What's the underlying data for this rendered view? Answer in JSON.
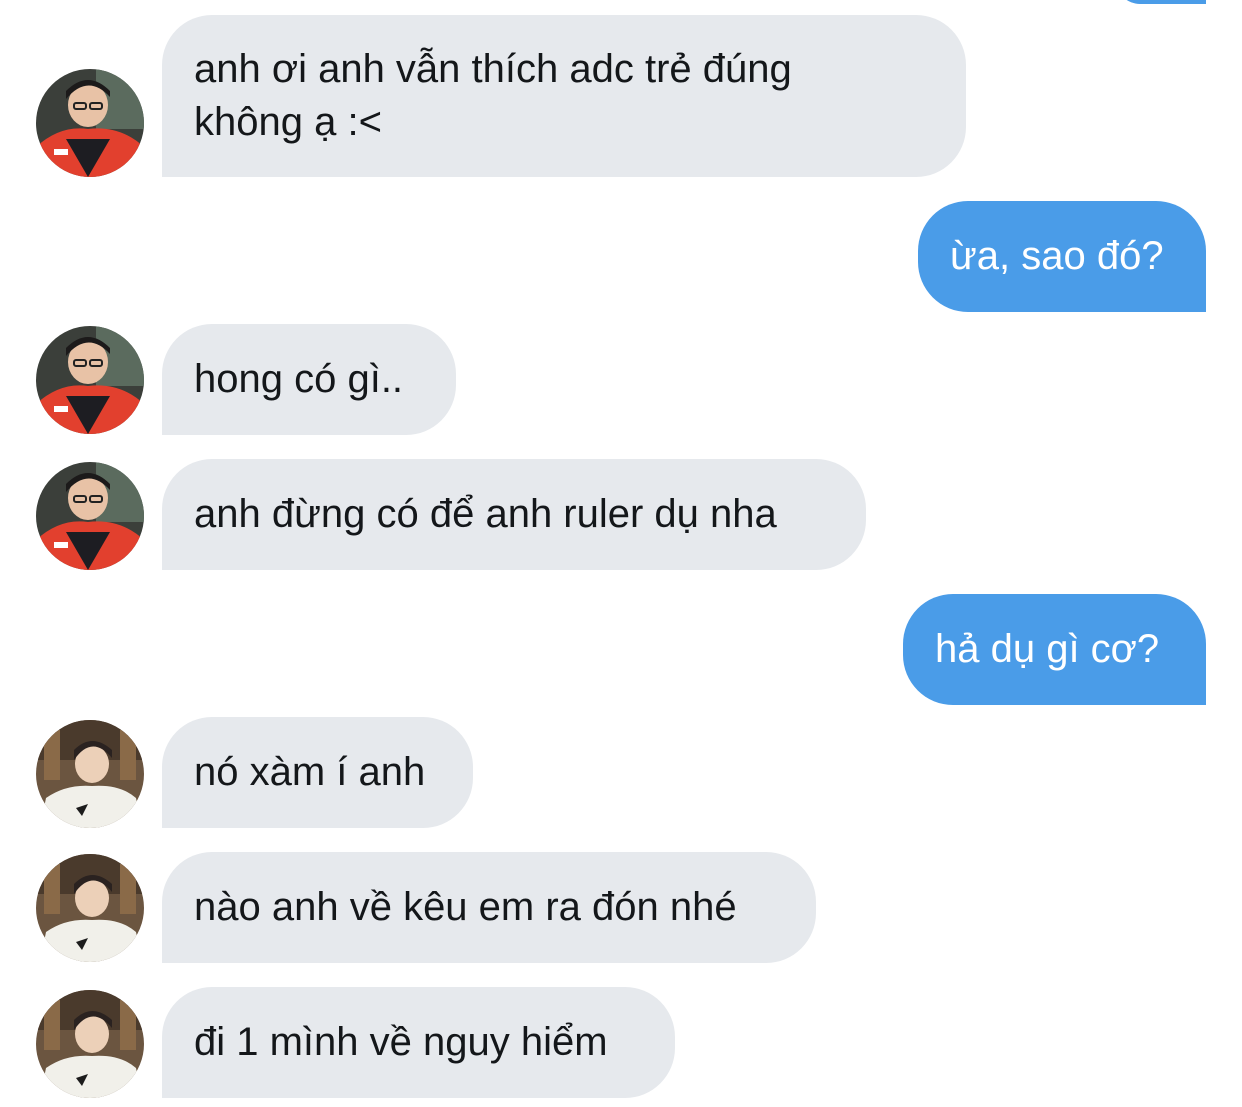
{
  "conversation": {
    "messages": [
      {
        "side": "in",
        "text": "anh ơi anh vẫn thích adc trẻ đúng\nkhông ạ :<",
        "avatar": "avatar-a"
      },
      {
        "side": "out",
        "text": "ừa, sao đó?"
      },
      {
        "side": "in",
        "text": "hong có gì..",
        "avatar": "avatar-a"
      },
      {
        "side": "in",
        "text": "anh đừng có để anh ruler dụ nha",
        "avatar": "avatar-a"
      },
      {
        "side": "out",
        "text": "hả dụ gì cơ?"
      },
      {
        "side": "in",
        "text": "nó xàm í anh",
        "avatar": "avatar-b"
      },
      {
        "side": "in",
        "text": "nào anh về kêu em ra đón nhé",
        "avatar": "avatar-b"
      },
      {
        "side": "in",
        "text": "đi 1 mình về nguy hiểm",
        "avatar": "avatar-b"
      }
    ]
  },
  "colors": {
    "incoming_bubble": "#e6e9ed",
    "outgoing_bubble": "#4a9ce8",
    "incoming_text": "#14171a",
    "outgoing_text": "#ffffff"
  }
}
